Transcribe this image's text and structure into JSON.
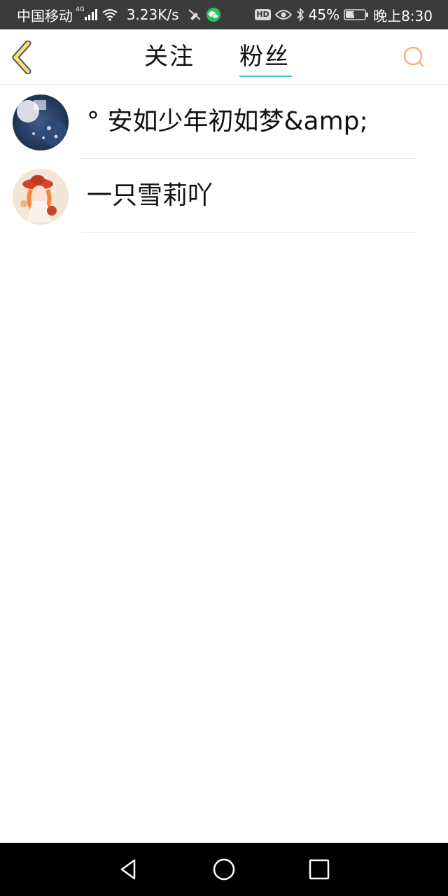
{
  "status_bar": {
    "carrier": "中国移动",
    "network_type": "4G",
    "speed": "3.23K/s",
    "hd": "HD",
    "battery_percent": "45%",
    "time": "晚上8:30",
    "battery_level": 0.45
  },
  "header": {
    "back_icon": "chevron-left-icon",
    "tabs": [
      {
        "label": "关注",
        "active": false
      },
      {
        "label": "粉丝",
        "active": true
      }
    ],
    "search_icon": "search-icon"
  },
  "fans": [
    {
      "name": "° 安如少年初如梦&amp;"
    },
    {
      "name": "一只雪莉吖"
    }
  ],
  "colors": {
    "status_bar_bg": "#3b3b3b",
    "back_chevron_fill": "#f5e27a",
    "back_chevron_stroke": "#555555",
    "tab_underline": "#4db8d9",
    "search_icon": "#f0b080",
    "nav_bar_bg": "#000000"
  }
}
